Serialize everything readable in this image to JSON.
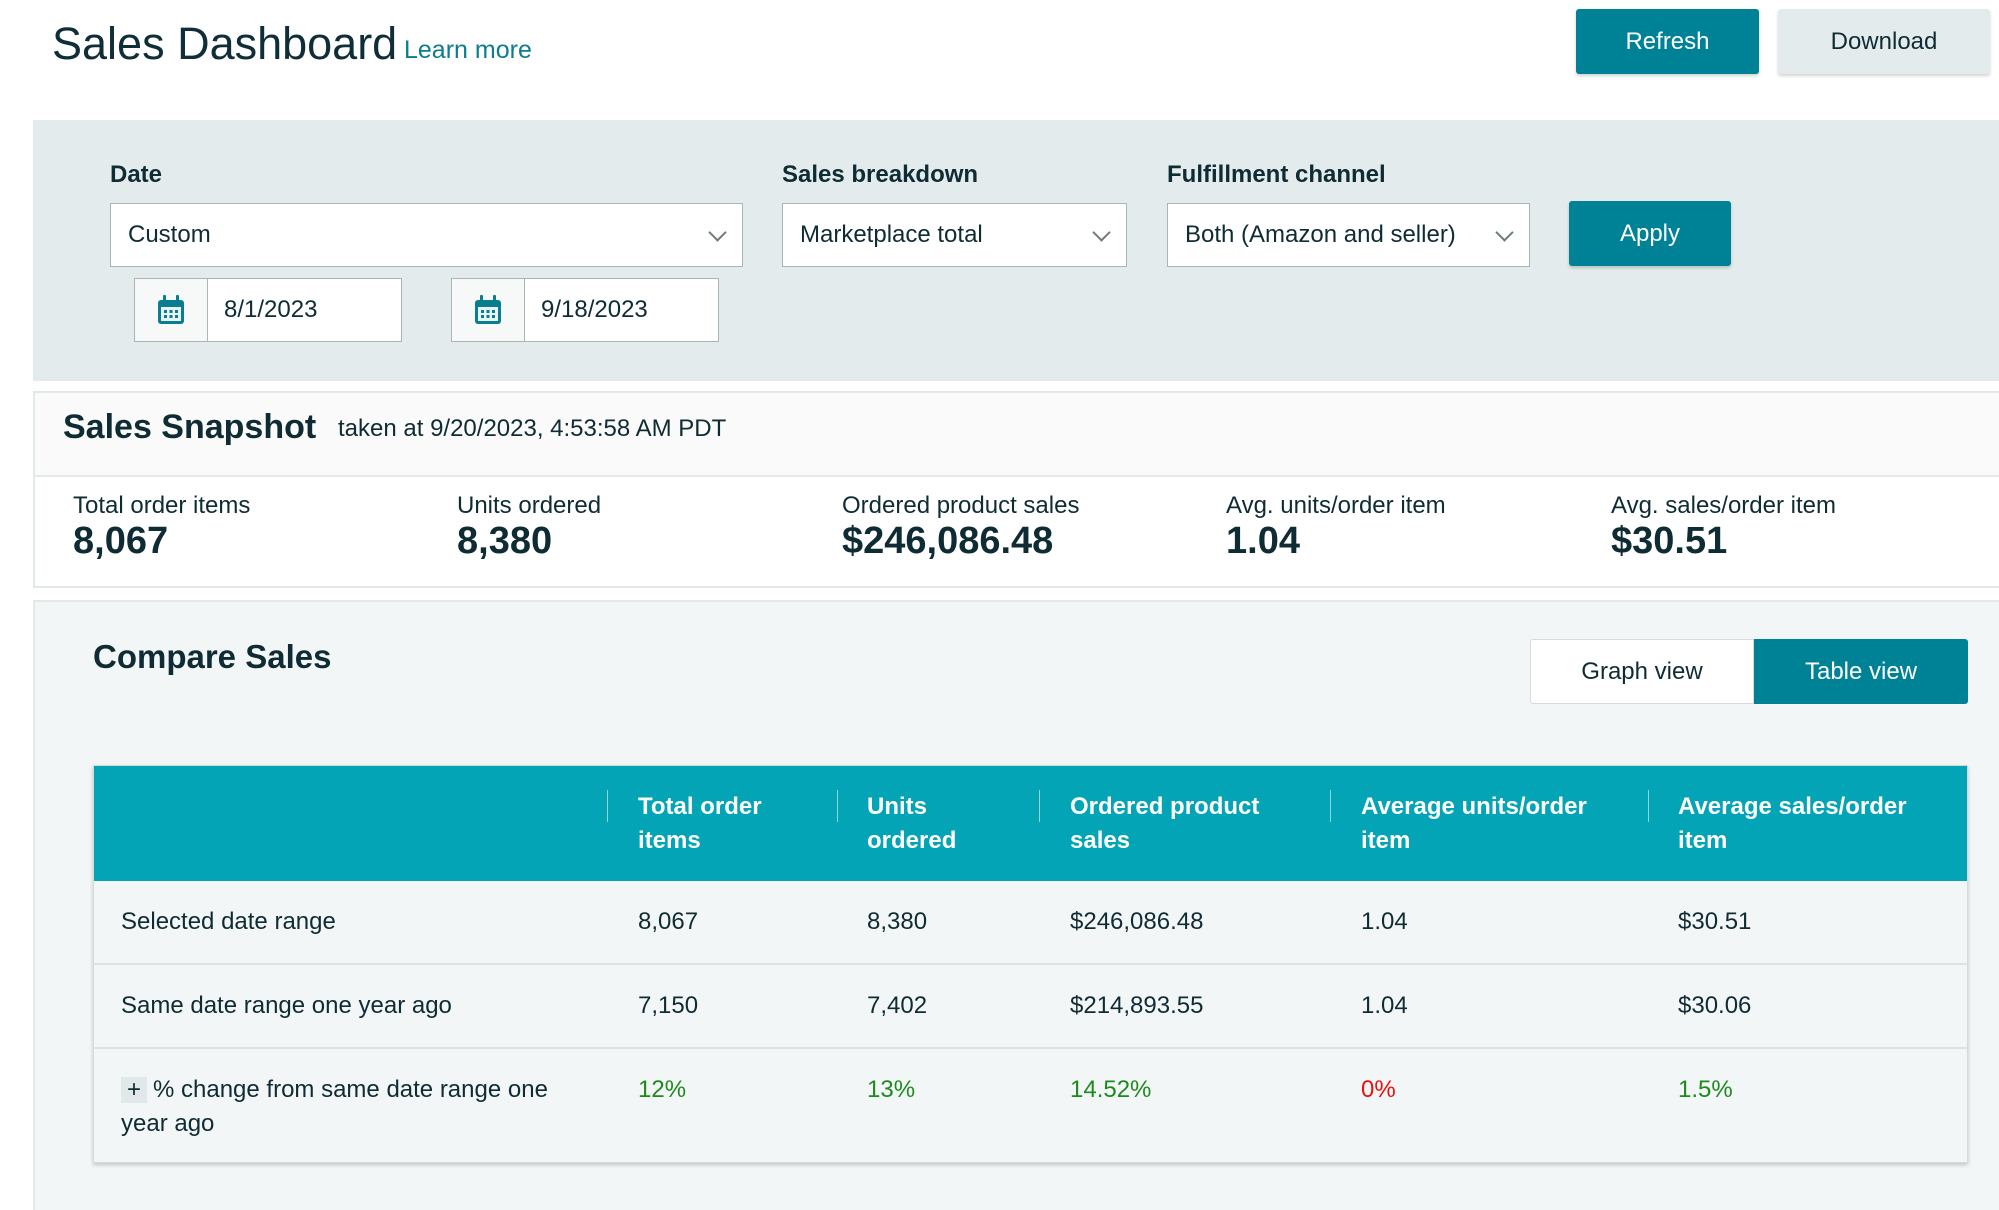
{
  "header": {
    "title": "Sales Dashboard",
    "learn_more": "Learn more",
    "refresh_label": "Refresh",
    "download_label": "Download"
  },
  "filters": {
    "date": {
      "label": "Date",
      "value": "Custom",
      "start": "8/1/2023",
      "end": "9/18/2023"
    },
    "sales_breakdown": {
      "label": "Sales breakdown",
      "value": "Marketplace total"
    },
    "fulfillment": {
      "label": "Fulfillment channel",
      "value": "Both (Amazon and seller)"
    },
    "apply_label": "Apply"
  },
  "snapshot": {
    "title": "Sales Snapshot",
    "taken_at": "taken at 9/20/2023, 4:53:58 AM PDT",
    "metrics": [
      {
        "label": "Total order items",
        "value": "8,067"
      },
      {
        "label": "Units ordered",
        "value": "8,380"
      },
      {
        "label": "Ordered product sales",
        "value": "$246,086.48"
      },
      {
        "label": "Avg. units/order item",
        "value": "1.04"
      },
      {
        "label": "Avg. sales/order item",
        "value": "$30.51"
      }
    ]
  },
  "compare": {
    "title": "Compare Sales",
    "views": [
      {
        "label": "Graph view",
        "active": false
      },
      {
        "label": "Table view",
        "active": true
      }
    ],
    "table": {
      "columns": [
        "",
        "Total order items",
        "Units ordered",
        "Ordered product sales",
        "Average units/order item",
        "Average sales/order item"
      ],
      "rows": [
        {
          "label": "Selected date range",
          "values": [
            "8,067",
            "8,380",
            "$246,086.48",
            "1.04",
            "$30.51"
          ]
        },
        {
          "label": "Same date range one year ago",
          "values": [
            "7,150",
            "7,402",
            "$214,893.55",
            "1.04",
            "$30.06"
          ]
        },
        {
          "label": "% change from same date range one year ago",
          "expand_icon": "plus-icon",
          "values": [
            "12%",
            "13%",
            "14.52%",
            "0%",
            "1.5%"
          ],
          "value_status": [
            "positive",
            "positive",
            "positive",
            "neutral",
            "positive"
          ]
        }
      ]
    }
  },
  "colors": {
    "primary": "#008296",
    "table_header": "#02a4b5",
    "positive": "#1d8a1d",
    "neutral": "#e8100f",
    "panel": "#e3ebec"
  }
}
